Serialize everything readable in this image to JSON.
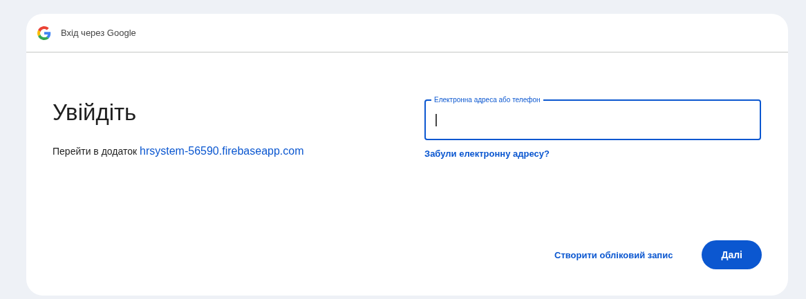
{
  "header": {
    "title": "Вхід через Google"
  },
  "heading": "Увійдіть",
  "subtitle": {
    "text": "Перейти в додаток",
    "link": "hrsystem-56590.firebaseapp.com"
  },
  "email_field": {
    "label": "Електронна адреса або телефон",
    "focused": true
  },
  "forgot_link": "Забули електронну адресу?",
  "create_account": "Створити обліковий запис",
  "next_button": "Далі"
}
